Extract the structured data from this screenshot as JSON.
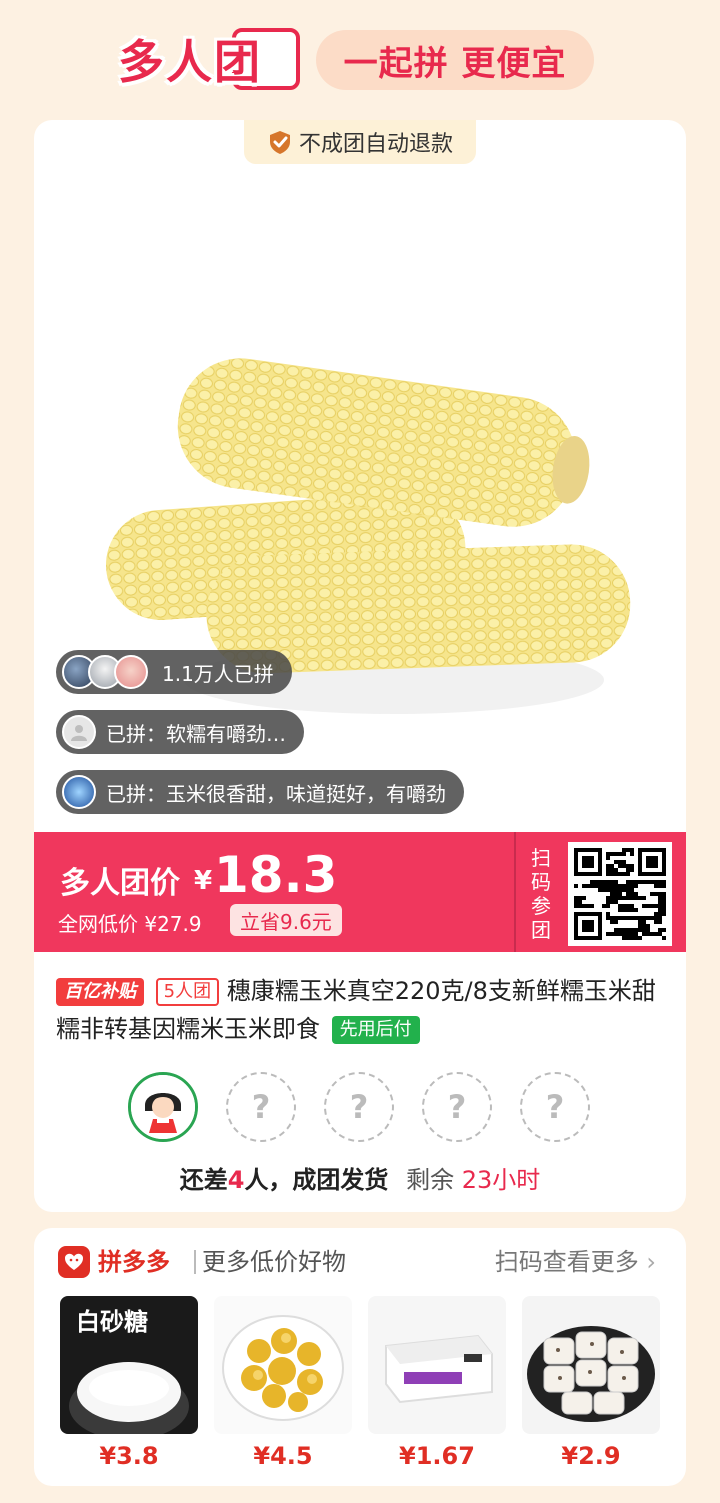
{
  "header": {
    "brand_title": "多人团",
    "slogan": "一起拼 更便宜"
  },
  "refund_badge": {
    "text": "不成团自动退款",
    "icon": "shield-check-icon"
  },
  "buyers": {
    "count_text": "1.1万人已拼",
    "reviews": [
      "已拼：软糯有嚼劲…",
      "已拼：玉米很香甜，味道挺好，有嚼劲"
    ]
  },
  "price": {
    "label": "多人团价",
    "currency": "¥",
    "value": "18.3",
    "original": "全网低价 ¥27.9",
    "save": "立省9.6元",
    "scan_label": "扫码参团"
  },
  "product": {
    "tag_subsidy": "百亿补贴",
    "tag_group": "5人团",
    "title": "穗康糯玉米真空220克/8支新鲜糯玉米甜糯非转基因糯米玉米即食",
    "tag_pay": "先用后付"
  },
  "group_status": {
    "need_prefix": "还差",
    "need_num": "4",
    "need_suffix": "人，成团发货",
    "remaining_label": "剩余",
    "remaining_time": "23小时",
    "empty_slot_mark": "?"
  },
  "recommend": {
    "brand": "拼多多",
    "subtitle": "更多低价好物",
    "more": "扫码查看更多",
    "items": [
      {
        "label": "白砂糖",
        "price": "¥3.8"
      },
      {
        "label": "",
        "price": "¥4.5"
      },
      {
        "label": "",
        "price": "¥1.67"
      },
      {
        "label": "",
        "price": "¥2.9"
      }
    ]
  },
  "colors": {
    "accent": "#e8294d",
    "banner": "#f0375d",
    "background": "#fdf1e2",
    "green": "#22b14c"
  }
}
